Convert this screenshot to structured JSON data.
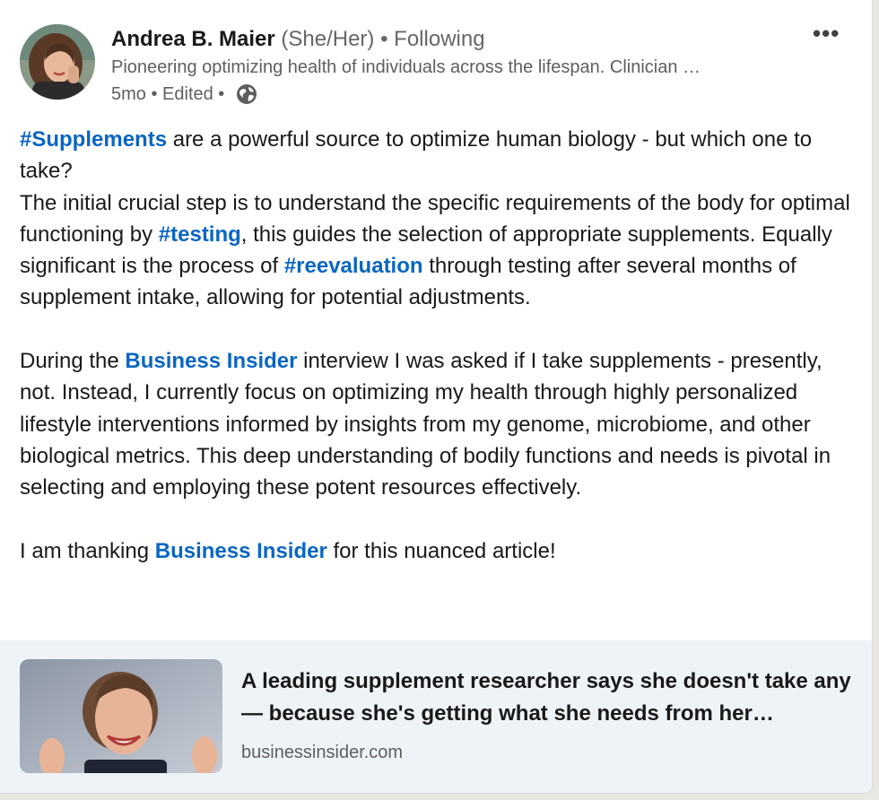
{
  "post": {
    "author": {
      "name": "Andrea B. Maier",
      "pronouns": "(She/Her)",
      "separator": "•",
      "follow_status": "Following",
      "headline": "Pioneering optimizing health of individuals across the lifespan. Clinician …",
      "time": "5mo",
      "edited": "Edited",
      "visibility_icon": "globe-icon"
    },
    "more_label": "•••",
    "body": {
      "p1_hashtag": "#Supplements",
      "p1_a": " are a powerful source to optimize human biology - but which one to take?",
      "p2_a": "The initial crucial step is to understand the specific requirements of the body for optimal functioning by ",
      "p2_hashtag1": "#testing",
      "p2_b": ", this guides the selection of appropriate supplements. Equally significant is the process of ",
      "p2_hashtag2": "#reevaluation",
      "p2_c": " through testing after several months of supplement intake, allowing for potential adjustments.",
      "p3_a": "During the ",
      "p3_mention": "Business Insider",
      "p3_b": " interview I was asked if I take supplements - presently, not. Instead, I currently focus on optimizing my health through highly personalized lifestyle interventions informed by insights from my genome, microbiome, and other biological metrics. This deep understanding of bodily functions and needs is pivotal in selecting and employing these potent resources effectively.",
      "p4_a": "I am thanking ",
      "p4_mention": "Business Insider",
      "p4_b": " for this nuanced article!"
    },
    "article": {
      "title": "A leading supplement researcher says she doesn't take any — because she's getting what she needs from her…",
      "source": "businessinsider.com"
    }
  },
  "colors": {
    "link": "#0a66c2",
    "text": "#191919",
    "muted": "#5e5e5e",
    "article_bg": "#eef3f8"
  }
}
